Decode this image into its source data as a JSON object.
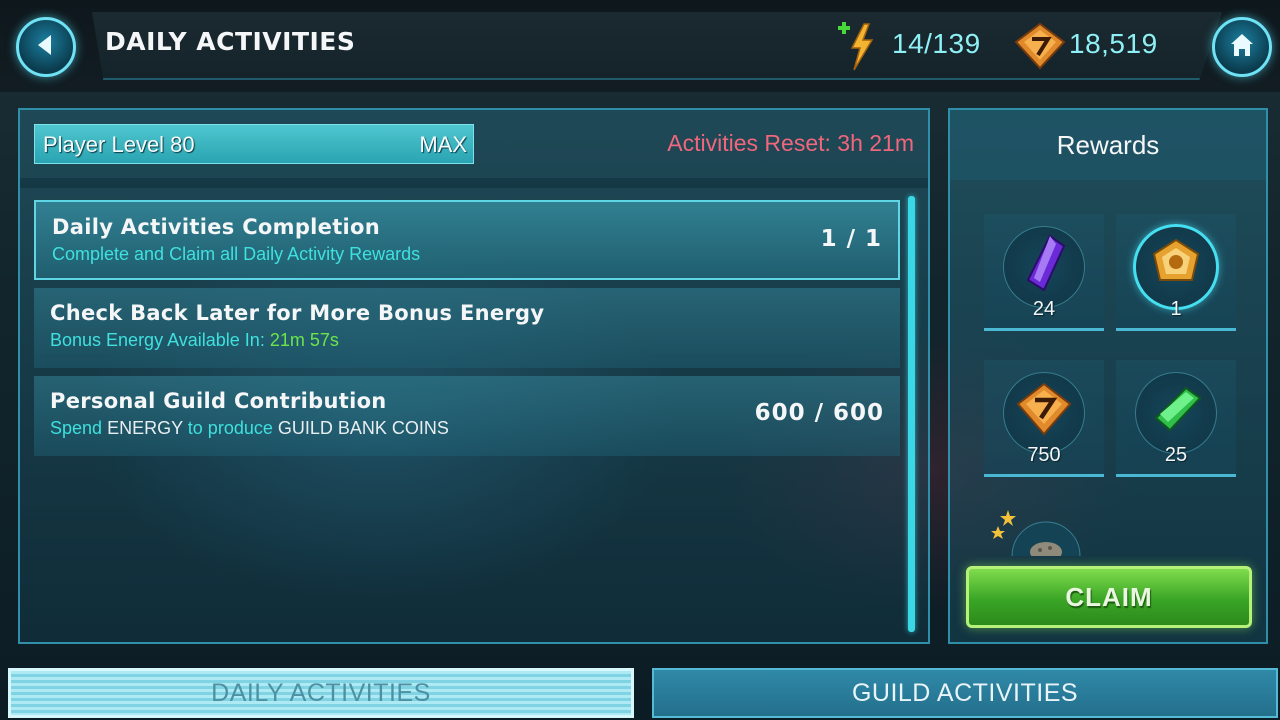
{
  "header": {
    "title": "DAILY ACTIVITIES",
    "energy": "14/139",
    "coins": "18,519",
    "back_icon": "back-arrow-icon",
    "home_icon": "home-icon"
  },
  "main": {
    "level_label": "Player Level 80",
    "level_status": "MAX",
    "level_progress": 1.0,
    "reset_text": "Activities Reset: 3h 21m",
    "activities": [
      {
        "title": "Daily Activities Completion",
        "subtitle": "Complete and Claim all Daily Activity Rewards",
        "count": "1 / 1"
      },
      {
        "title": "Check Back Later for More Bonus Energy",
        "subtitle_prefix": "Bonus Energy Available In:",
        "subtitle_time": "21m 57s",
        "count": ""
      },
      {
        "title": "Personal Guild Contribution",
        "subtitle_part1": "Spend",
        "subtitle_part2": "ENERGY",
        "subtitle_part3": "to produce",
        "subtitle_part4": "GUILD BANK COINS",
        "count": "600 / 600"
      }
    ]
  },
  "rewards": {
    "title": "Rewards",
    "items": [
      {
        "icon": "purple-crystal-icon",
        "qty": "24"
      },
      {
        "icon": "gold-emblem-icon",
        "qty": "1"
      },
      {
        "icon": "guild-coin-icon",
        "qty": "750"
      },
      {
        "icon": "green-ticket-icon",
        "qty": "25"
      },
      {
        "icon": "star-orb-icon",
        "qty": ""
      }
    ],
    "claim_label": "CLAIM"
  },
  "tabs": [
    {
      "label": "DAILY ACTIVITIES",
      "active": true
    },
    {
      "label": "GUILD ACTIVITIES",
      "active": false
    }
  ],
  "colors": {
    "accent_cyan": "#46dff0",
    "reset_red": "#f0667c",
    "claim_green": "#3aa526",
    "timer_green": "#6ce44a"
  }
}
